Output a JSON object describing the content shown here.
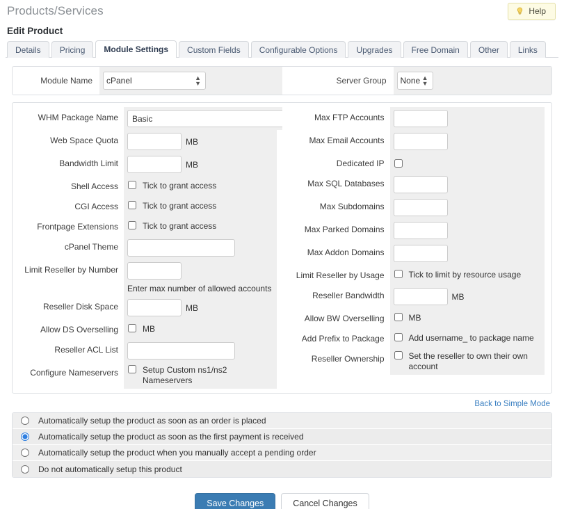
{
  "header": {
    "title": "Products/Services",
    "subtitle": "Edit Product",
    "help_label": "Help",
    "help_icon": "lightbulb-icon"
  },
  "tabs": [
    {
      "label": "Details",
      "active": false
    },
    {
      "label": "Pricing",
      "active": false
    },
    {
      "label": "Module Settings",
      "active": true
    },
    {
      "label": "Custom Fields",
      "active": false
    },
    {
      "label": "Configurable Options",
      "active": false
    },
    {
      "label": "Upgrades",
      "active": false
    },
    {
      "label": "Free Domain",
      "active": false
    },
    {
      "label": "Other",
      "active": false
    },
    {
      "label": "Links",
      "active": false
    }
  ],
  "module_bar": {
    "module_name_label": "Module Name",
    "module_name_value": "cPanel",
    "server_group_label": "Server Group",
    "server_group_value": "None"
  },
  "fields_left": [
    {
      "label": "WHM Package Name",
      "type": "text",
      "value": "Basic",
      "width": "lg",
      "unit": ""
    },
    {
      "label": "Web Space Quota",
      "type": "text",
      "value": "",
      "width": "sm",
      "unit": "MB"
    },
    {
      "label": "Bandwidth Limit",
      "type": "text",
      "value": "",
      "width": "sm",
      "unit": "MB"
    },
    {
      "label": "Shell Access",
      "type": "checkbox",
      "checked": false,
      "text": "Tick to grant access"
    },
    {
      "label": "CGI Access",
      "type": "checkbox",
      "checked": false,
      "text": "Tick to grant access"
    },
    {
      "label": "Frontpage Extensions",
      "type": "checkbox",
      "checked": false,
      "text": "Tick to grant access"
    },
    {
      "label": "cPanel Theme",
      "type": "text",
      "value": "",
      "width": "md",
      "unit": ""
    },
    {
      "label": "Limit Reseller by Number",
      "type": "text",
      "value": "",
      "width": "sm",
      "unit": "Enter max number of allowed accounts"
    },
    {
      "label": "Reseller Disk Space",
      "type": "text",
      "value": "",
      "width": "sm",
      "unit": "MB"
    },
    {
      "label": "Allow DS Overselling",
      "type": "checkbox",
      "checked": false,
      "text": "MB"
    },
    {
      "label": "Reseller ACL List",
      "type": "text",
      "value": "",
      "width": "md",
      "unit": ""
    },
    {
      "label": "Configure Nameservers",
      "type": "checkbox",
      "checked": false,
      "text": "Setup Custom ns1/ns2 Nameservers"
    }
  ],
  "fields_right": [
    {
      "label": "Max FTP Accounts",
      "type": "text",
      "value": "",
      "width": "sm",
      "unit": ""
    },
    {
      "label": "Max Email Accounts",
      "type": "text",
      "value": "",
      "width": "sm",
      "unit": ""
    },
    {
      "label": "Dedicated IP",
      "type": "checkbox",
      "checked": false,
      "text": ""
    },
    {
      "label": "Max SQL Databases",
      "type": "text",
      "value": "",
      "width": "sm",
      "unit": ""
    },
    {
      "label": "Max Subdomains",
      "type": "text",
      "value": "",
      "width": "sm",
      "unit": ""
    },
    {
      "label": "Max Parked Domains",
      "type": "text",
      "value": "",
      "width": "sm",
      "unit": ""
    },
    {
      "label": "Max Addon Domains",
      "type": "text",
      "value": "",
      "width": "sm",
      "unit": ""
    },
    {
      "label": "Limit Reseller by Usage",
      "type": "checkbox",
      "checked": false,
      "text": "Tick to limit by resource usage"
    },
    {
      "label": "Reseller Bandwidth",
      "type": "text",
      "value": "",
      "width": "sm",
      "unit": "MB"
    },
    {
      "label": "Allow BW Overselling",
      "type": "checkbox",
      "checked": false,
      "text": "MB"
    },
    {
      "label": "Add Prefix to Package",
      "type": "checkbox",
      "checked": false,
      "text": "Add username_ to package name"
    },
    {
      "label": "Reseller Ownership",
      "type": "checkbox",
      "checked": false,
      "text": "Set the reseller to own their own account"
    }
  ],
  "simple_mode_link": "Back to Simple Mode",
  "auto_setup_options": [
    {
      "label": "Automatically setup the product as soon as an order is placed",
      "selected": false
    },
    {
      "label": "Automatically setup the product as soon as the first payment is received",
      "selected": true
    },
    {
      "label": "Automatically setup the product when you manually accept a pending order",
      "selected": false
    },
    {
      "label": "Do not automatically setup this product",
      "selected": false
    }
  ],
  "footer": {
    "save_label": "Save Changes",
    "cancel_label": "Cancel Changes"
  },
  "colors": {
    "primary": "#3b7cb3",
    "link": "#3a7fc1",
    "radio_selected": "#2f7fe0",
    "help_bg": "#fdfbe4",
    "field_bg": "#efefef"
  }
}
